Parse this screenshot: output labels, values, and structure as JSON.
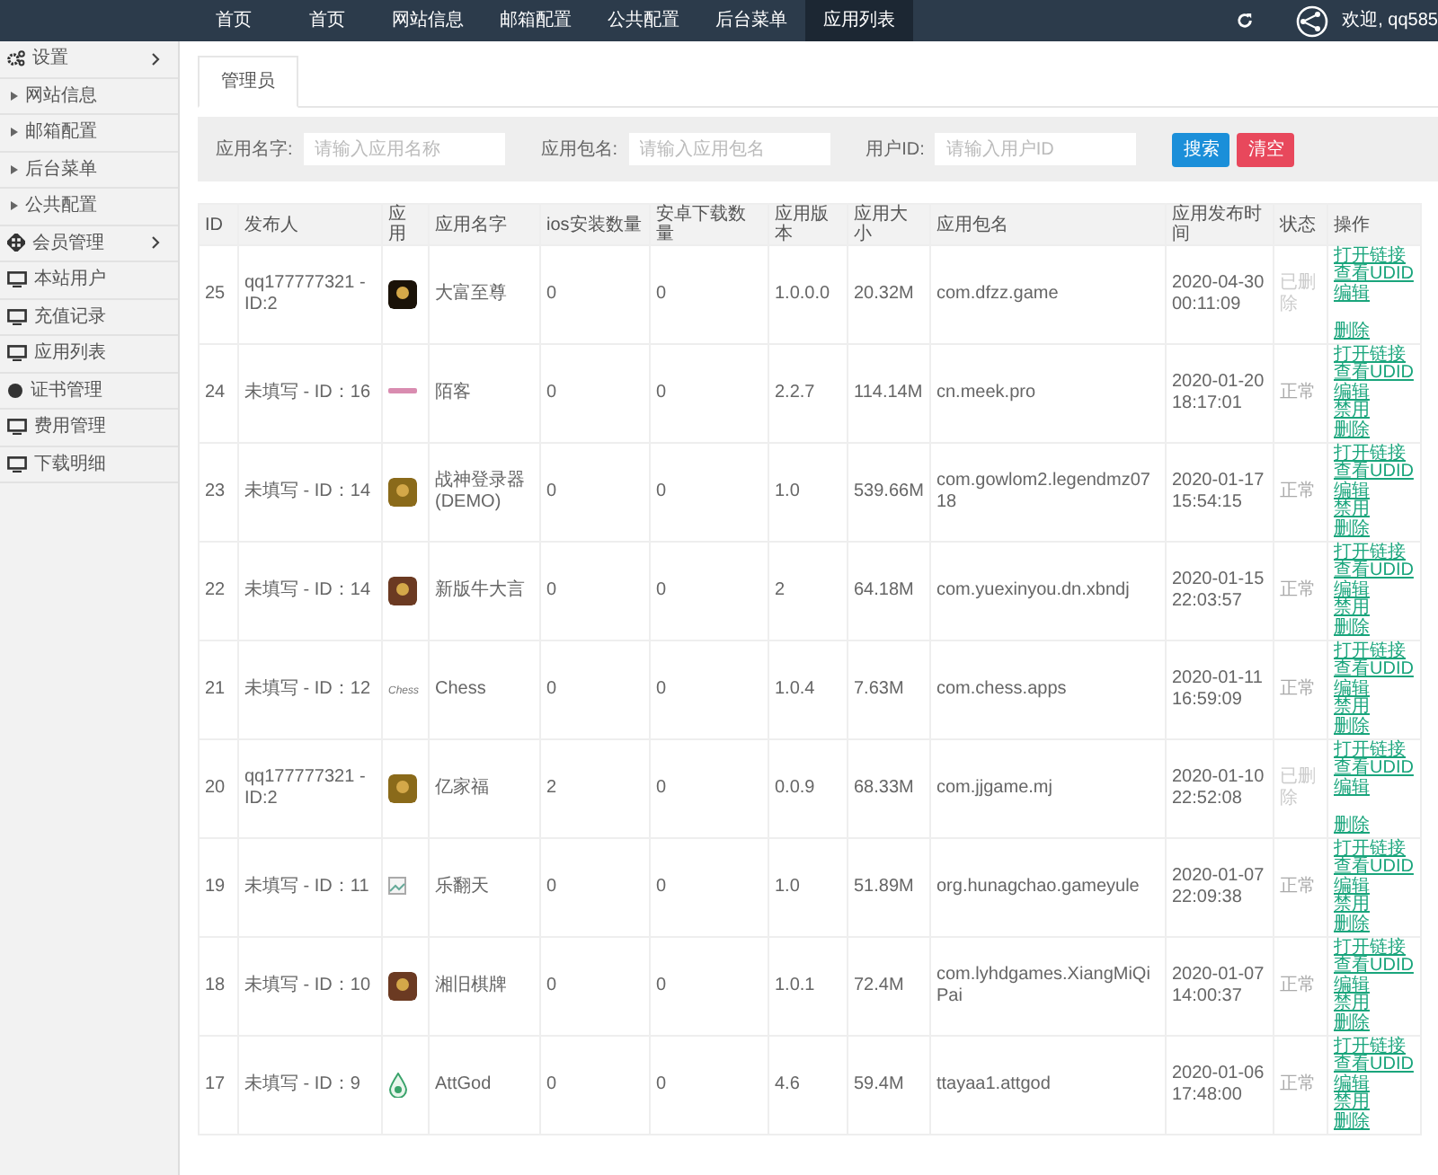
{
  "top_nav": {
    "items": [
      {
        "label": "首页",
        "selected": false
      },
      {
        "label": "首页",
        "selected": false
      },
      {
        "label": "网站信息",
        "selected": false
      },
      {
        "label": "邮箱配置",
        "selected": false
      },
      {
        "label": "公共配置",
        "selected": false
      },
      {
        "label": "后台菜单",
        "selected": false
      },
      {
        "label": "应用列表",
        "selected": true
      }
    ],
    "welcome": "欢迎, qq585"
  },
  "sidebar": {
    "items": [
      {
        "label": "设置",
        "kind": "group",
        "children": [
          {
            "label": "网站信息"
          },
          {
            "label": "邮箱配置"
          },
          {
            "label": "后台菜单"
          },
          {
            "label": "公共配置"
          }
        ]
      },
      {
        "label": "会员管理",
        "kind": "group"
      },
      {
        "label": "本站用户",
        "kind": "page"
      },
      {
        "label": "充值记录",
        "kind": "page"
      },
      {
        "label": "应用列表",
        "kind": "page"
      },
      {
        "label": "证书管理",
        "kind": "page"
      },
      {
        "label": "费用管理",
        "kind": "page"
      },
      {
        "label": "下载明细",
        "kind": "page"
      }
    ]
  },
  "tabs": [
    {
      "label": "管理员",
      "selected": true
    }
  ],
  "search": {
    "fields": [
      {
        "label": "应用名字:",
        "placeholder": "请输入应用名称"
      },
      {
        "label": "应用包名:",
        "placeholder": "请输入应用包名"
      },
      {
        "label": "用户ID:",
        "placeholder": "请输入用户ID"
      }
    ],
    "buttons": [
      {
        "label": "搜索",
        "kind": "primary"
      },
      {
        "label": "清空",
        "kind": "danger"
      }
    ]
  },
  "table": {
    "columns": [
      "ID",
      "发布人",
      "应用",
      "应用名字",
      "ios安装数量",
      "安卓下载数量",
      "应用版本",
      "应用大小",
      "应用包名",
      "应用发布时间",
      "状态",
      "操作"
    ],
    "rows": [
      {
        "id": "25",
        "publisher": "qq177777321 - ID:2",
        "name": "大富至尊",
        "ios": "0",
        "android": "0",
        "version": "1.0.0.0",
        "size": "20.32M",
        "package": "com.dfzz.game",
        "time": "2020-04-30 00:11:09",
        "status": {
          "label": "已删除",
          "kind": "deleted"
        },
        "actions": [
          "打开链接",
          "查看UDID",
          "编辑",
          "删除"
        ]
      },
      {
        "id": "24",
        "publisher": "未填写 - ID：16",
        "name": "陌客",
        "ios": "0",
        "android": "0",
        "version": "2.2.7",
        "size": "114.14M",
        "package": "cn.meek.pro",
        "time": "2020-01-20 18:17:01",
        "status": {
          "label": "正常",
          "kind": "normal"
        },
        "actions": [
          "打开链接",
          "查看UDID",
          "编辑",
          "禁用",
          "删除"
        ]
      },
      {
        "id": "23",
        "publisher": "未填写 - ID：14",
        "name": "战神登录器(DEMO)",
        "ios": "0",
        "android": "0",
        "version": "1.0",
        "size": "539.66M",
        "package": "com.gowlom2.legendmz0718",
        "time": "2020-01-17 15:54:15",
        "status": {
          "label": "正常",
          "kind": "normal"
        },
        "actions": [
          "打开链接",
          "查看UDID",
          "编辑",
          "禁用",
          "删除"
        ]
      },
      {
        "id": "22",
        "publisher": "未填写 - ID：14",
        "name": "新版牛大言",
        "ios": "0",
        "android": "0",
        "version": "2",
        "size": "64.18M",
        "package": "com.yuexinyou.dn.xbndj",
        "time": "2020-01-15 22:03:57",
        "status": {
          "label": "正常",
          "kind": "normal"
        },
        "actions": [
          "打开链接",
          "查看UDID",
          "编辑",
          "禁用",
          "删除"
        ]
      },
      {
        "id": "21",
        "publisher": "未填写 - ID：12",
        "logo_text": "Chess",
        "name": "Chess",
        "ios": "0",
        "android": "0",
        "version": "1.0.4",
        "size": "7.63M",
        "package": "com.chess.apps",
        "time": "2020-01-11 16:59:09",
        "status": {
          "label": "正常",
          "kind": "normal"
        },
        "actions": [
          "打开链接",
          "查看UDID",
          "编辑",
          "禁用",
          "删除"
        ]
      },
      {
        "id": "20",
        "publisher": "qq177777321 - ID:2",
        "name": "亿家福",
        "ios": "2",
        "android": "0",
        "version": "0.0.9",
        "size": "68.33M",
        "package": "com.jjgame.mj",
        "time": "2020-01-10 22:52:08",
        "status": {
          "label": "已删除",
          "kind": "deleted"
        },
        "actions": [
          "打开链接",
          "查看UDID",
          "编辑",
          "删除"
        ]
      },
      {
        "id": "19",
        "publisher": "未填写 - ID：11",
        "name": "乐翻天",
        "ios": "0",
        "android": "0",
        "version": "1.0",
        "size": "51.89M",
        "package": "org.hunagchao.gameyule",
        "time": "2020-01-07 22:09:38",
        "status": {
          "label": "正常",
          "kind": "normal"
        },
        "actions": [
          "打开链接",
          "查看UDID",
          "编辑",
          "禁用",
          "删除"
        ]
      },
      {
        "id": "18",
        "publisher": "未填写 - ID：10",
        "name": "湘旧棋牌",
        "ios": "0",
        "android": "0",
        "version": "1.0.1",
        "size": "72.4M",
        "package": "com.lyhdgames.XiangMiQiPai",
        "time": "2020-01-07 14:00:37",
        "status": {
          "label": "正常",
          "kind": "normal"
        },
        "actions": [
          "打开链接",
          "查看UDID",
          "编辑",
          "禁用",
          "删除"
        ]
      },
      {
        "id": "17",
        "publisher": "未填写 - ID：9",
        "name": "AttGod",
        "ios": "0",
        "android": "0",
        "version": "4.6",
        "size": "59.4M",
        "package": "ttayaa1.attgod",
        "time": "2020-01-06 17:48:00",
        "status": {
          "label": "正常",
          "kind": "normal"
        },
        "actions": [
          "打开链接",
          "查看UDID",
          "编辑",
          "禁用",
          "删除"
        ]
      }
    ]
  }
}
